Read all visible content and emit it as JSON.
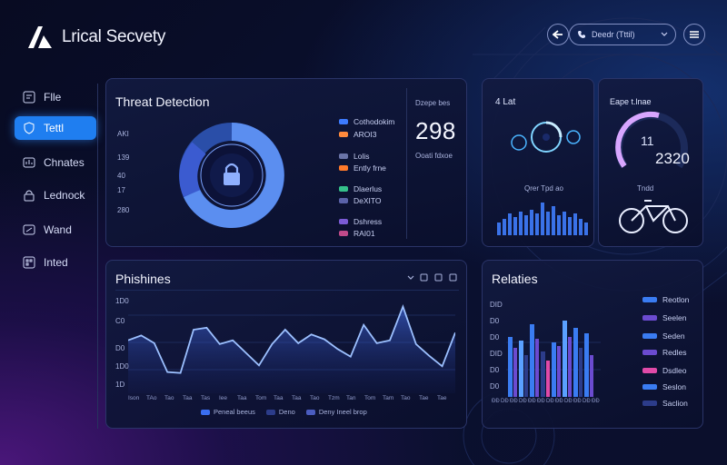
{
  "header": {
    "app_name": "Lrical Secvety",
    "search_text": "Deedr (Tttil)",
    "icons": [
      "logo-mark",
      "back-arrow-icon",
      "phone-icon",
      "chevron-down-icon",
      "menu-icon"
    ]
  },
  "sidebar": {
    "items": [
      {
        "label": "Flle",
        "icon": "file-icon",
        "active": false
      },
      {
        "label": "Tettl",
        "icon": "shield-icon",
        "active": true
      },
      {
        "label": "Chnates",
        "icon": "chart-icon",
        "active": false
      },
      {
        "label": "Lednock",
        "icon": "lock-icon",
        "active": false
      },
      {
        "label": "Wand",
        "icon": "wand-icon",
        "active": false
      },
      {
        "label": "Inted",
        "icon": "grid-icon",
        "active": false
      }
    ]
  },
  "threat_panel": {
    "title": "Threat Detection",
    "side_labels": [
      "AKI",
      "139",
      "40",
      "17",
      "280"
    ],
    "legend": [
      {
        "label": "Cothodokim",
        "color": "#3d7bff"
      },
      {
        "label": "AROI3",
        "color": "#ff8a3d"
      },
      {
        "label": "Lolis",
        "color": "#6a74a8"
      },
      {
        "label": "Ently frne",
        "color": "#ff7a2a"
      },
      {
        "label": "Dlaerlus",
        "color": "#35c08a"
      },
      {
        "label": "DeXITO",
        "color": "#5a62a8"
      },
      {
        "label": "Dshress",
        "color": "#7b5bd6"
      },
      {
        "label": "RAI01",
        "color": "#c04a8a"
      }
    ],
    "stat_label": "Dzepe bes",
    "stat_value": "298",
    "stat_sub": "Ooati fdxoe"
  },
  "radar_panel": {
    "title": "4 Lat",
    "caption": "Qrer Tpd ao"
  },
  "gauge_panel": {
    "title": "Eape t.lnae",
    "value_small": "11",
    "value_large": "2320",
    "caption": "Tndd"
  },
  "line_panel": {
    "title": "Phishines",
    "icons": [
      "chevron-down-icon",
      "grid-icon",
      "copy-icon",
      "layers-icon"
    ],
    "y_labels": [
      "1D0",
      "C0",
      "D0",
      "1D0",
      "1D"
    ],
    "x_labels": [
      "Ison",
      "TAo",
      "Tao",
      "Taa",
      "Tas",
      "Iee",
      "Taa",
      "Tom",
      "Taa",
      "Taa",
      "Tao",
      "Tzm",
      "Tan",
      "Tom",
      "Tam",
      "Tao",
      "Tae",
      "Tae"
    ],
    "legend": [
      "Peneal beeus",
      "Deno",
      "Deny Ineel brop"
    ],
    "chart_data": {
      "type": "area",
      "x": [
        0,
        1,
        2,
        3,
        4,
        5,
        6,
        7,
        8,
        9,
        10,
        11,
        12,
        13,
        14,
        15,
        16,
        17,
        18,
        19,
        20,
        21,
        22,
        23,
        24,
        25
      ],
      "values": [
        55,
        60,
        52,
        22,
        21,
        66,
        68,
        51,
        55,
        42,
        29,
        51,
        66,
        52,
        61,
        56,
        46,
        38,
        71,
        52,
        55,
        90,
        51,
        39,
        28,
        63
      ],
      "ylim": [
        0,
        100
      ]
    }
  },
  "relatives_panel": {
    "title": "Relaties",
    "y_labels": [
      "DID",
      "D0",
      "D0",
      "DID",
      "D0",
      "D0"
    ],
    "x_labels": [
      "ĐĐ",
      "DĐ",
      "ĐĐ",
      "DĐ",
      "ĐĐ",
      "ĐĐ",
      "DĐ",
      "ĐĐ",
      "DĐ",
      "ĐĐ",
      "DĐ",
      "ĐĐ"
    ],
    "legend": [
      {
        "label": "Reotlon",
        "color": "#3a7cf2"
      },
      {
        "label": "Seelen",
        "color": "#6b4bd0"
      },
      {
        "label": "Seden",
        "color": "#3a7cf2"
      },
      {
        "label": "Redles",
        "color": "#6b4bd0"
      },
      {
        "label": "Dsdleo",
        "color": "#e04aa8"
      },
      {
        "label": "Seslon",
        "color": "#3a7cf2"
      },
      {
        "label": "Saclion",
        "color": "#2c3c8a"
      }
    ]
  }
}
